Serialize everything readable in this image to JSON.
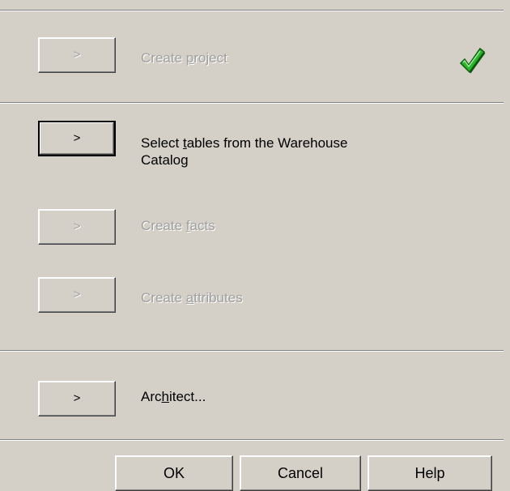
{
  "steps": [
    {
      "button_label": ">",
      "text": "Create project",
      "mnemonic": "p",
      "enabled": false,
      "completed": true
    },
    {
      "button_label": ">",
      "text": "Select tables from the Warehouse Catalog",
      "mnemonic": "t",
      "enabled": true,
      "completed": false
    },
    {
      "button_label": ">",
      "text": "Create facts",
      "mnemonic": "f",
      "enabled": false,
      "completed": false
    },
    {
      "button_label": ">",
      "text": "Create attributes",
      "mnemonic": "a",
      "enabled": false,
      "completed": false
    },
    {
      "button_label": ">",
      "text": "Architect...",
      "mnemonic": "h",
      "enabled": true,
      "completed": false
    }
  ],
  "footer": {
    "ok_label": "OK",
    "cancel_label": "Cancel",
    "help_label": "Help"
  },
  "icons": {
    "completed": "green-checkmark-icon"
  },
  "colors": {
    "dialog_background": "#d4d0c8",
    "disabled_text": "#a0a0a0",
    "check_green": "#2bb52b"
  }
}
